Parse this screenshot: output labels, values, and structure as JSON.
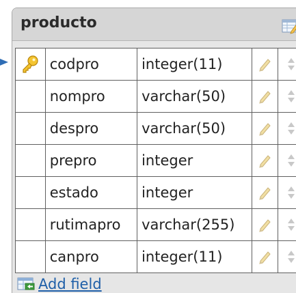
{
  "table": {
    "name": "producto"
  },
  "fields": [
    {
      "name": "codpro",
      "type": "integer(11)",
      "primary_key": true
    },
    {
      "name": "nompro",
      "type": "varchar(50)",
      "primary_key": false
    },
    {
      "name": "despro",
      "type": "varchar(50)",
      "primary_key": false
    },
    {
      "name": "prepro",
      "type": "integer",
      "primary_key": false
    },
    {
      "name": "estado",
      "type": "integer",
      "primary_key": false
    },
    {
      "name": "rutimapro",
      "type": "varchar(255)",
      "primary_key": false
    },
    {
      "name": "canpro",
      "type": "integer(11)",
      "primary_key": false
    }
  ],
  "footer": {
    "add_field_label": "Add field"
  },
  "icons": {
    "pointer": "arrow-right-icon",
    "table_edit": "table-edit-icon",
    "primary_key": "key-icon",
    "edit": "pencil-icon",
    "move": "up-down-arrows-icon",
    "add_field": "add-field-icon"
  },
  "colors": {
    "panel_bg": "#e6e6e6",
    "header_bg": "#d6d6d6",
    "link": "#1f5fa8",
    "pointer": "#2f6db5"
  }
}
